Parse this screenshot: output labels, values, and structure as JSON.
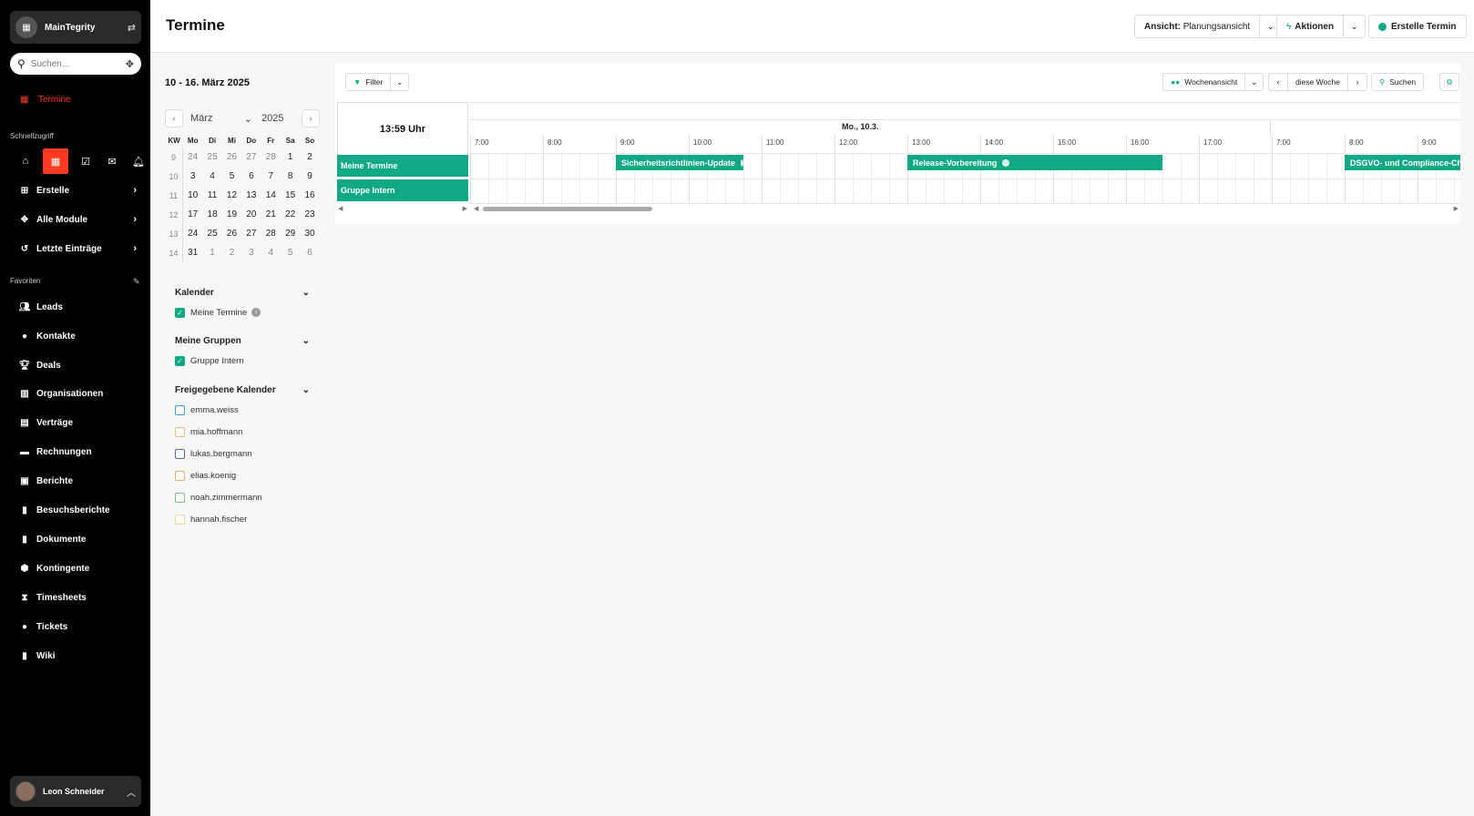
{
  "sidebar": {
    "org_name": "MainTegrity",
    "search_placeholder": "Suchen...",
    "active_item": "Termine",
    "quick_access_label": "Schnellzugriff",
    "menu_items": [
      {
        "label": "Erstelle",
        "icon": "plus-square-icon"
      },
      {
        "label": "Alle Module",
        "icon": "puzzle-icon"
      },
      {
        "label": "Letzte Einträge",
        "icon": "history-icon"
      }
    ],
    "favorites_label": "Favoriten",
    "favorites": [
      {
        "label": "Leads",
        "icon": "users-icon"
      },
      {
        "label": "Kontakte",
        "icon": "user-icon"
      },
      {
        "label": "Deals",
        "icon": "trophy-icon"
      },
      {
        "label": "Organisationen",
        "icon": "building-icon"
      },
      {
        "label": "Verträge",
        "icon": "file-contract-icon"
      },
      {
        "label": "Rechnungen",
        "icon": "credit-card-icon"
      },
      {
        "label": "Berichte",
        "icon": "report-icon"
      },
      {
        "label": "Besuchsberichte",
        "icon": "file-icon"
      },
      {
        "label": "Dokumente",
        "icon": "document-icon"
      },
      {
        "label": "Kontingente",
        "icon": "box-icon"
      },
      {
        "label": "Timesheets",
        "icon": "hourglass-icon"
      },
      {
        "label": "Tickets",
        "icon": "comment-icon"
      },
      {
        "label": "Wiki",
        "icon": "wiki-icon"
      }
    ],
    "user_name": "Leon Schneider"
  },
  "header": {
    "title": "Termine",
    "view_prefix": "Ansicht:",
    "view_value": "Planungsansicht",
    "actions_label": "Aktionen",
    "create_label": "Erstelle Termin"
  },
  "left": {
    "range_title": "10 - 16. März 2025",
    "mini_cal": {
      "month": "März",
      "year": "2025",
      "weekday_headers": [
        "KW",
        "Mo",
        "Di",
        "Mi",
        "Do",
        "Fr",
        "Sa",
        "So"
      ],
      "weeks": [
        {
          "kw": "9",
          "days": [
            "24",
            "25",
            "26",
            "27",
            "28",
            "1",
            "2"
          ]
        },
        {
          "kw": "10",
          "days": [
            "3",
            "4",
            "5",
            "6",
            "7",
            "8",
            "9"
          ]
        },
        {
          "kw": "11",
          "days": [
            "10",
            "11",
            "12",
            "13",
            "14",
            "15",
            "16"
          ]
        },
        {
          "kw": "12",
          "days": [
            "17",
            "18",
            "19",
            "20",
            "21",
            "22",
            "23"
          ]
        },
        {
          "kw": "13",
          "days": [
            "24",
            "25",
            "26",
            "27",
            "28",
            "29",
            "30"
          ]
        },
        {
          "kw": "14",
          "days": [
            "31",
            "1",
            "2",
            "3",
            "4",
            "5",
            "6"
          ]
        }
      ]
    },
    "calendars_title": "Kalender",
    "my_calendar": "Meine Termine",
    "groups_title": "Meine Gruppen",
    "group": "Gruppe Intern",
    "shared_title": "Freigegebene Kalender",
    "shared": [
      {
        "name": "emma.weiss",
        "color": "#3aa0c8"
      },
      {
        "name": "mia.hoffmann",
        "color": "#d9c27a"
      },
      {
        "name": "lukas.bergmann",
        "color": "#5a6fa8"
      },
      {
        "name": "elias.koenig",
        "color": "#e0b060"
      },
      {
        "name": "noah.zimmermann",
        "color": "#7bbf8a"
      },
      {
        "name": "hannah.fischer",
        "color": "#efd98a"
      }
    ]
  },
  "scheduler": {
    "filter_label": "Filter",
    "week_view_label": "Wochenansicht",
    "this_week_label": "diese Woche",
    "search_label": "Suchen",
    "current_time": "13:59 Uhr",
    "day_label": "Mo., 10.3.",
    "hours": [
      "7:00",
      "8:00",
      "9:00",
      "10:00",
      "11:00",
      "12:00",
      "13:00",
      "14:00",
      "15:00",
      "16:00",
      "17:00",
      "7:00",
      "8:00",
      "9:00"
    ],
    "resources": [
      "Meine Termine",
      "Gruppe Intern"
    ],
    "events": [
      {
        "title": "Sicherheitsrichtlinien-Update",
        "resource": "Meine Termine",
        "start": "9:00",
        "end": "10:45"
      },
      {
        "title": "Release-Vorbereitung",
        "resource": "Meine Termine",
        "start": "13:00",
        "end": "16:30"
      },
      {
        "title": "DSGVO- und Compliance-Check",
        "resource": "Meine Termine",
        "start": "8:00"
      }
    ]
  },
  "colors": {
    "accent": "#11a886",
    "active_red": "#ff3b1f",
    "sidebar_bg": "#000000"
  }
}
